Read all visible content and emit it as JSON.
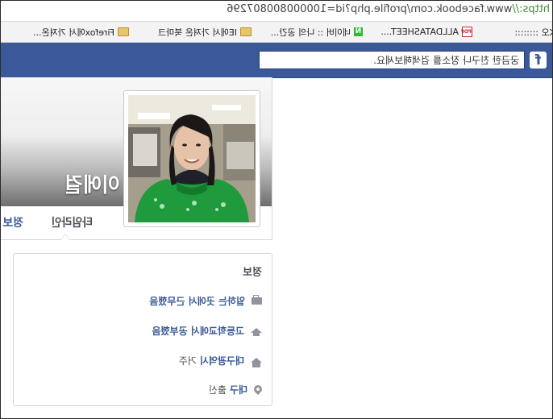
{
  "browser": {
    "url_scheme": "https://",
    "url_rest": "www.facebook.com/profile.php?id=100000800807296"
  },
  "bookmarks": [
    {
      "label": "LK오 ::::::::",
      "icon": "document-icon"
    },
    {
      "label": "ALLDATASHEET....",
      "icon": "pdf-icon"
    },
    {
      "label": "네이버 :: 나의 공간...",
      "icon": "naver-icon"
    },
    {
      "label": "IE에서 가져온 북마크",
      "icon": "folder-icon"
    },
    {
      "label": "Firefox에서 가져온...",
      "icon": "folder-icon"
    }
  ],
  "facebook": {
    "logo": "f",
    "search_placeholder": "궁금한 친구나 장소를 검색해보세요."
  },
  "profile": {
    "name": "이에걸",
    "tabs": {
      "timeline": "타임라인",
      "about": "정보"
    }
  },
  "about": {
    "title": "정보",
    "rows": [
      {
        "icon": "briefcase-icon",
        "link": "일하는 곳에서 근무했음",
        "text": ""
      },
      {
        "icon": "graduation-cap-icon",
        "link": "고등학교에서 공부했음",
        "text": ""
      },
      {
        "icon": "home-icon",
        "link": "대구광역시",
        "text": "거주"
      },
      {
        "icon": "location-pin-icon",
        "link": "대구",
        "text": "출신"
      }
    ]
  },
  "colors": {
    "facebook_blue": "#3b5998",
    "link": "#3b5998",
    "muted": "#90949c"
  }
}
